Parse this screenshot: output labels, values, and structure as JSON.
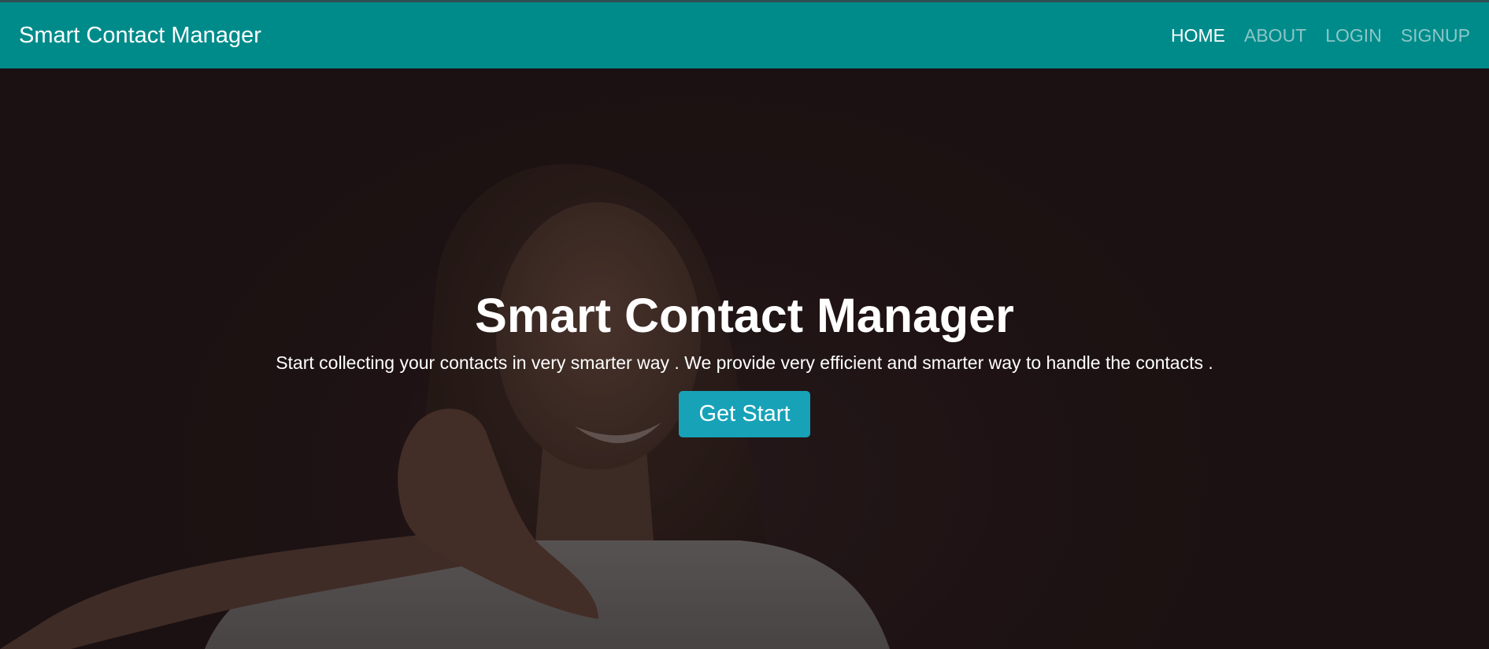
{
  "navbar": {
    "brand": "Smart Contact Manager",
    "links": [
      {
        "label": "HOME",
        "active": true
      },
      {
        "label": "ABOUT",
        "active": false
      },
      {
        "label": "LOGIN",
        "active": false
      },
      {
        "label": "SIGNUP",
        "active": false
      }
    ]
  },
  "hero": {
    "title": "Smart Contact Manager",
    "description": "Start collecting your contacts in very smarter way . We provide very efficient and smarter way to handle the contacts .",
    "cta_label": "Get Start",
    "background_image": "woman-making-phone-gesture-photo"
  },
  "colors": {
    "navbar": "#008b8b",
    "cta": "#17a2b8",
    "hero_background": "#221517"
  }
}
